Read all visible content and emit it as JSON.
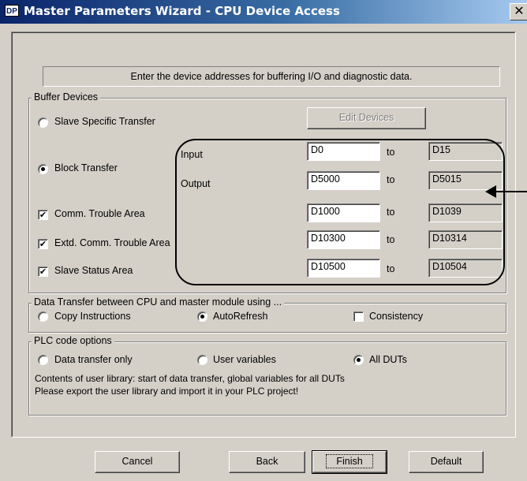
{
  "window": {
    "title": "Master Parameters Wizard - CPU Device Access",
    "icon_text": "DP",
    "close_glyph": "✕"
  },
  "info_text": "Enter the device addresses for buffering I/O and diagnostic data.",
  "buffer_devices": {
    "label": "Buffer Devices",
    "slave_specific_transfer": {
      "label": "Slave Specific Transfer",
      "selected": false
    },
    "edit_devices_label": "Edit Devices",
    "block_transfer": {
      "label": "Block Transfer",
      "selected": true
    },
    "input": {
      "label": "Input",
      "from": "D0",
      "to_label": "to",
      "to": "D15"
    },
    "output": {
      "label": "Output",
      "from": "D5000",
      "to_label": "to",
      "to": "D5015"
    },
    "comm_trouble": {
      "label": "Comm. Trouble Area",
      "checked": true,
      "from": "D1000",
      "to_label": "to",
      "to": "D1039"
    },
    "extd_comm_trouble": {
      "label": "Extd. Comm. Trouble Area",
      "checked": true,
      "from": "D10300",
      "to_label": "to",
      "to": "D10314"
    },
    "slave_status": {
      "label": "Slave Status Area",
      "checked": true,
      "from": "D10500",
      "to_label": "to",
      "to": "D10504"
    }
  },
  "data_transfer": {
    "label": "Data Transfer between CPU and master module using ...",
    "copy_instructions": {
      "label": "Copy Instructions",
      "selected": false
    },
    "auto_refresh": {
      "label": "AutoRefresh",
      "selected": true
    },
    "consistency": {
      "label": "Consistency",
      "checked": false
    }
  },
  "plc_code": {
    "label": "PLC code options",
    "data_transfer_only": {
      "label": "Data transfer only",
      "selected": false
    },
    "user_variables": {
      "label": "User variables",
      "selected": false
    },
    "all_duts": {
      "label": "All DUTs",
      "selected": true
    },
    "description_line1": "Contents of user library: start of data transfer, global variables for all DUTs",
    "description_line2": "Please export the user library and import it in your PLC project!"
  },
  "buttons": {
    "cancel": "Cancel",
    "back": "Back",
    "finish": "Finish",
    "default": "Default"
  },
  "check_glyph": "✔"
}
